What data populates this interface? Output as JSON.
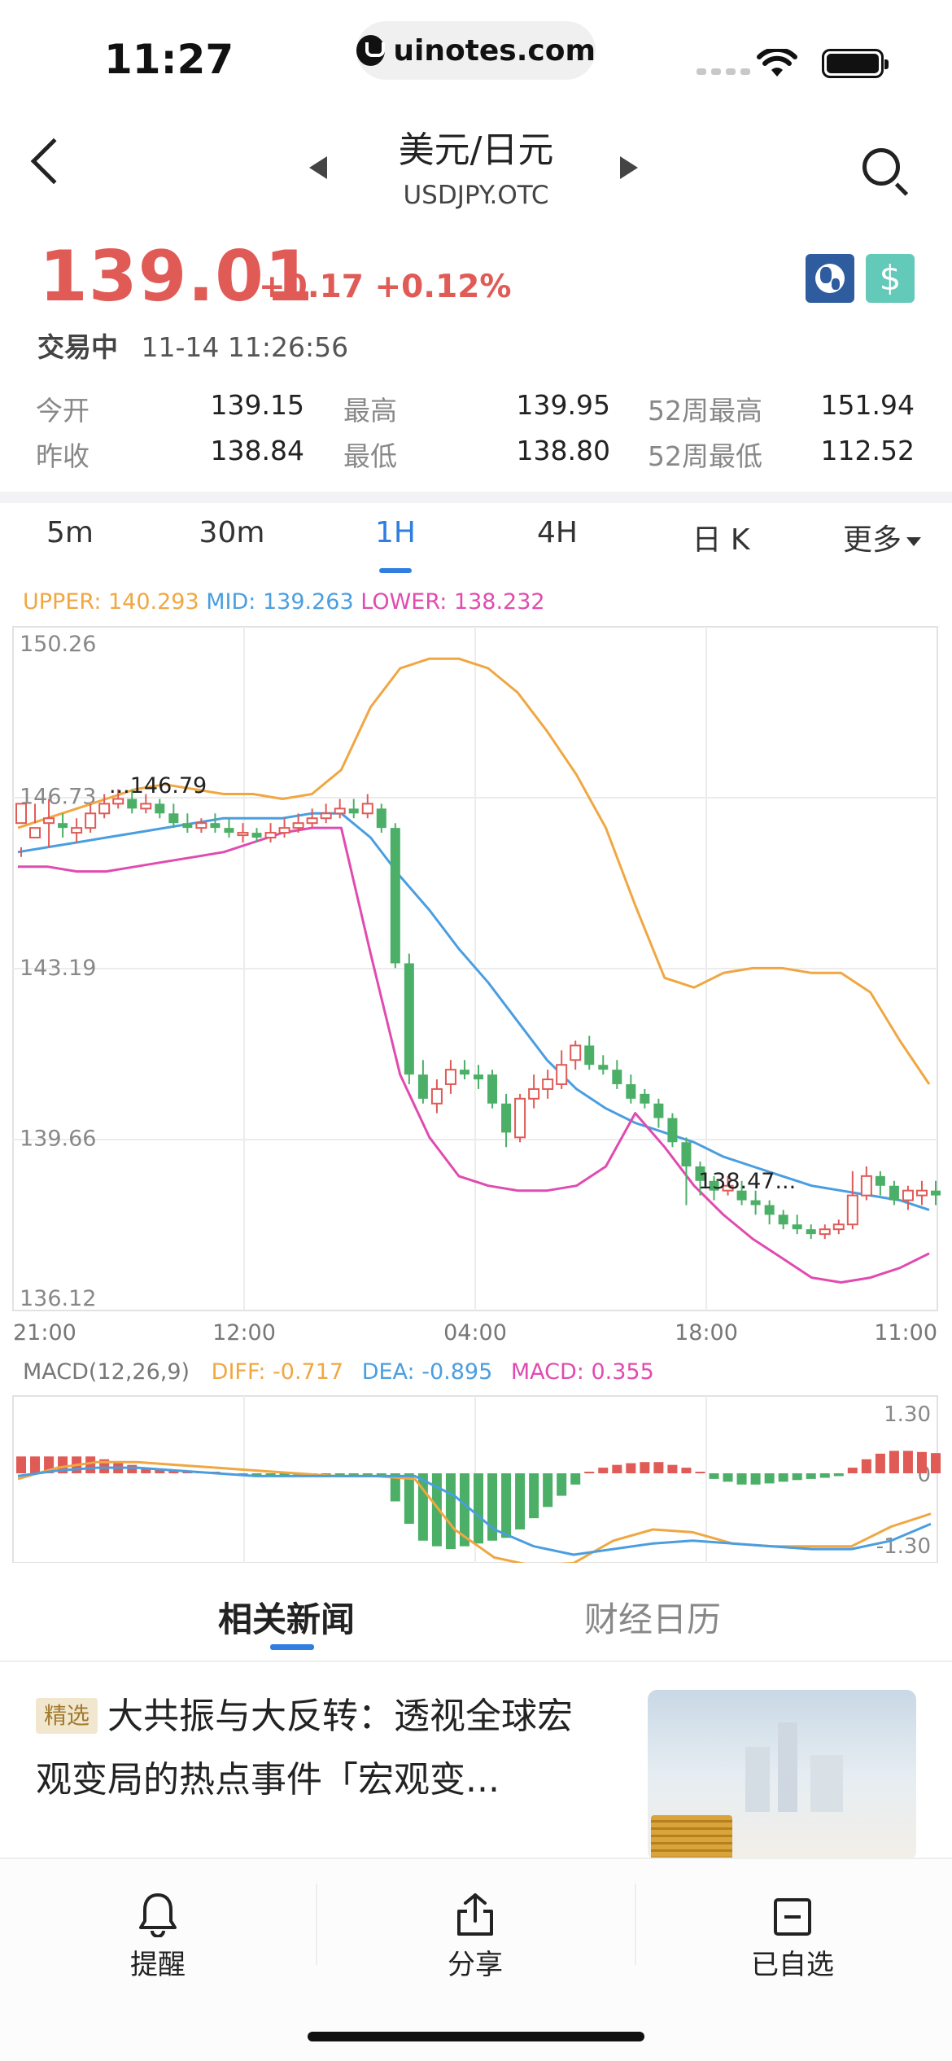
{
  "status_bar": {
    "time": "11:27",
    "site": "uinotes.com"
  },
  "nav": {
    "title": "美元/日元",
    "subtitle": "USDJPY.OTC"
  },
  "quote": {
    "price": "139.01",
    "change": "+0.17",
    "change_pct": "+0.12%",
    "state": "交易中",
    "timestamp": "11-14 11:26:56"
  },
  "stats": {
    "row1": [
      {
        "label": "今开",
        "value": "139.15"
      },
      {
        "label": "最高",
        "value": "139.95"
      },
      {
        "label": "52周最高",
        "value": "151.94"
      }
    ],
    "row2": [
      {
        "label": "昨收",
        "value": "138.84"
      },
      {
        "label": "最低",
        "value": "138.80"
      },
      {
        "label": "52周最低",
        "value": "112.52"
      }
    ]
  },
  "tabs": [
    "5m",
    "30m",
    "1H",
    "4H",
    "日 K",
    "更多"
  ],
  "active_tab": "1H",
  "colors": {
    "up": "#e05a56",
    "down": "#4caf67",
    "upper": "#f0a742",
    "mid": "#4a9ee0",
    "lower": "#e04bb0",
    "accent": "#2f7ee0"
  },
  "boll_legend": {
    "upper": "UPPER: 140.293",
    "mid": "MID: 139.263",
    "lower": "LOWER: 138.232"
  },
  "macd_legend": {
    "title": "MACD(12,26,9)",
    "diff": "DIFF: -0.717",
    "dea": "DEA: -0.895",
    "macd": "MACD: 0.355"
  },
  "chart_data": [
    {
      "type": "candlestick",
      "indicator": "BOLL",
      "y_ticks": [
        "150.26",
        "146.73",
        "143.19",
        "139.66",
        "136.12"
      ],
      "ylim": [
        136.12,
        150.26
      ],
      "x_ticks": [
        "21:00",
        "12:00",
        "04:00",
        "18:00",
        "11:00"
      ],
      "annotations": [
        {
          "text": "...146.79"
        },
        {
          "text": "138.47..."
        }
      ],
      "candles": [
        [
          146.2,
          146.6,
          145.5,
          145.7
        ],
        [
          145.9,
          146.1,
          146.6,
          146.2
        ],
        [
          146.2,
          146.3,
          146.7,
          145.7
        ],
        [
          146.2,
          146.1,
          146.4,
          145.9
        ],
        [
          146.0,
          146.1,
          146.3,
          145.8
        ],
        [
          146.1,
          146.4,
          146.6,
          146.0
        ],
        [
          146.4,
          146.6,
          146.8,
          146.3
        ],
        [
          146.6,
          146.7,
          146.9,
          146.5
        ],
        [
          146.7,
          146.5,
          146.9,
          146.4
        ],
        [
          146.5,
          146.6,
          146.8,
          146.4
        ],
        [
          146.6,
          146.4,
          146.7,
          146.3
        ],
        [
          146.4,
          146.2,
          146.6,
          146.1
        ],
        [
          146.2,
          146.1,
          146.4,
          146.0
        ],
        [
          146.1,
          146.2,
          146.3,
          146.0
        ],
        [
          146.2,
          146.1,
          146.4,
          146.0
        ],
        [
          146.1,
          146.0,
          146.3,
          145.9
        ],
        [
          146.0,
          146.0,
          146.2,
          145.8
        ],
        [
          146.0,
          145.9,
          146.1,
          145.8
        ],
        [
          145.9,
          146.0,
          146.2,
          145.8
        ],
        [
          146.0,
          146.1,
          146.3,
          145.9
        ],
        [
          146.1,
          146.2,
          146.4,
          146.0
        ],
        [
          146.2,
          146.3,
          146.5,
          146.1
        ],
        [
          146.3,
          146.4,
          146.6,
          146.2
        ],
        [
          146.4,
          146.5,
          146.7,
          146.3
        ],
        [
          146.5,
          146.4,
          146.7,
          146.3
        ],
        [
          146.4,
          146.6,
          146.8,
          146.3
        ],
        [
          146.5,
          146.1,
          146.6,
          146.0
        ],
        [
          146.1,
          143.3,
          146.2,
          143.2
        ],
        [
          143.3,
          141.0,
          143.5,
          140.8
        ],
        [
          141.0,
          140.5,
          141.3,
          140.4
        ],
        [
          140.4,
          140.7,
          140.9,
          140.2
        ],
        [
          140.8,
          141.1,
          141.3,
          140.6
        ],
        [
          141.1,
          141.0,
          141.3,
          140.9
        ],
        [
          141.0,
          140.9,
          141.2,
          140.7
        ],
        [
          141.0,
          140.4,
          141.1,
          140.3
        ],
        [
          140.4,
          139.8,
          140.6,
          139.5
        ],
        [
          139.7,
          140.5,
          140.6,
          139.6
        ],
        [
          140.5,
          140.7,
          141.0,
          140.3
        ],
        [
          140.7,
          140.9,
          141.1,
          140.5
        ],
        [
          140.8,
          141.2,
          141.5,
          140.7
        ],
        [
          141.3,
          141.6,
          141.7,
          141.1
        ],
        [
          141.6,
          141.2,
          141.8,
          141.1
        ],
        [
          141.2,
          141.1,
          141.4,
          141.0
        ],
        [
          141.1,
          140.8,
          141.3,
          140.7
        ],
        [
          140.8,
          140.5,
          141.0,
          140.4
        ],
        [
          140.6,
          140.4,
          140.7,
          140.3
        ],
        [
          140.4,
          140.1,
          140.5,
          139.9
        ],
        [
          140.1,
          139.6,
          140.2,
          139.5
        ],
        [
          139.6,
          139.1,
          139.7,
          138.3
        ],
        [
          139.1,
          138.8,
          139.2,
          138.5
        ],
        [
          138.8,
          138.6,
          138.9,
          138.4
        ],
        [
          138.6,
          138.7,
          138.9,
          138.5
        ],
        [
          138.6,
          138.4,
          138.8,
          138.3
        ],
        [
          138.4,
          138.3,
          138.6,
          138.1
        ],
        [
          138.3,
          138.1,
          138.4,
          137.9
        ],
        [
          138.1,
          137.9,
          138.2,
          137.8
        ],
        [
          137.9,
          137.8,
          138.1,
          137.7
        ],
        [
          137.8,
          137.7,
          137.9,
          137.6
        ],
        [
          137.7,
          137.8,
          137.9,
          137.6
        ],
        [
          137.8,
          137.9,
          138.0,
          137.7
        ],
        [
          137.9,
          138.5,
          139.0,
          137.8
        ],
        [
          138.5,
          138.9,
          139.1,
          138.4
        ],
        [
          138.9,
          138.7,
          139.0,
          138.5
        ],
        [
          138.7,
          138.4,
          138.8,
          138.3
        ],
        [
          138.4,
          138.6,
          138.7,
          138.2
        ],
        [
          138.5,
          138.6,
          138.8,
          138.3
        ],
        [
          138.6,
          138.5,
          138.8,
          138.3
        ]
      ],
      "series": [
        {
          "name": "UPPER",
          "values": [
            146.1,
            146.3,
            146.5,
            146.7,
            146.9,
            147.0,
            146.9,
            146.8,
            146.8,
            146.7,
            146.8,
            147.3,
            148.6,
            149.4,
            149.6,
            149.6,
            149.4,
            148.9,
            148.1,
            147.2,
            146.1,
            144.5,
            143.0,
            142.8,
            143.1,
            143.2,
            143.2,
            143.1,
            143.1,
            142.7,
            141.7,
            140.8
          ]
        },
        {
          "name": "MID",
          "values": [
            145.6,
            145.7,
            145.8,
            145.9,
            146.0,
            146.1,
            146.2,
            146.3,
            146.3,
            146.3,
            146.4,
            146.4,
            145.9,
            145.1,
            144.4,
            143.6,
            142.9,
            142.1,
            141.3,
            140.7,
            140.3,
            140.0,
            139.8,
            139.6,
            139.3,
            139.1,
            138.9,
            138.7,
            138.6,
            138.5,
            138.4,
            138.2
          ]
        },
        {
          "name": "LOWER",
          "values": [
            145.3,
            145.3,
            145.2,
            145.2,
            145.3,
            145.4,
            145.5,
            145.6,
            145.8,
            146.0,
            146.1,
            146.1,
            143.5,
            141.0,
            139.7,
            138.9,
            138.7,
            138.6,
            138.6,
            138.7,
            139.1,
            140.2,
            139.5,
            138.7,
            138.1,
            137.6,
            137.2,
            136.8,
            136.7,
            136.8,
            137.0,
            137.3
          ]
        }
      ]
    },
    {
      "type": "bar+line",
      "indicator": "MACD(12,26,9)",
      "y_ticks": [
        "1.30",
        "0",
        "-1.30"
      ],
      "ylim": [
        -1.3,
        1.3
      ],
      "histogram": [
        0.3,
        0.3,
        0.3,
        0.3,
        0.3,
        0.3,
        0.25,
        0.2,
        0.15,
        0.1,
        0.08,
        0.05,
        0.03,
        0.02,
        0.0,
        -0.02,
        -0.03,
        -0.05,
        -0.05,
        -0.05,
        -0.04,
        -0.03,
        -0.02,
        -0.02,
        -0.02,
        -0.02,
        -0.05,
        -0.5,
        -0.9,
        -1.2,
        -1.3,
        -1.35,
        -1.3,
        -1.25,
        -1.2,
        -1.15,
        -1.0,
        -0.8,
        -0.6,
        -0.4,
        -0.2,
        0.0,
        0.1,
        0.15,
        0.18,
        0.2,
        0.2,
        0.15,
        0.1,
        0.0,
        -0.1,
        -0.15,
        -0.2,
        -0.2,
        -0.18,
        -0.15,
        -0.12,
        -0.1,
        -0.08,
        -0.05,
        0.1,
        0.25,
        0.35,
        0.4,
        0.4,
        0.38,
        0.36
      ],
      "series": [
        {
          "name": "DIFF",
          "values": [
            -0.1,
            0.1,
            0.2,
            0.2,
            0.15,
            0.1,
            0.05,
            0.0,
            -0.05,
            -0.05,
            -0.1,
            -1.0,
            -1.5,
            -1.65,
            -1.6,
            -1.2,
            -1.0,
            -1.05,
            -1.25,
            -1.3,
            -1.3,
            -1.3,
            -0.95,
            -0.72
          ]
        },
        {
          "name": "DEA",
          "values": [
            -0.05,
            0.05,
            0.1,
            0.1,
            0.05,
            0.0,
            -0.05,
            -0.05,
            -0.05,
            -0.05,
            -0.05,
            -0.4,
            -1.0,
            -1.3,
            -1.45,
            -1.35,
            -1.25,
            -1.2,
            -1.25,
            -1.3,
            -1.35,
            -1.35,
            -1.2,
            -0.9
          ]
        }
      ]
    }
  ],
  "news": {
    "tabs": [
      "相关新闻",
      "财经日历"
    ],
    "tag": "精选",
    "headline": "大共振与大反转：透视全球宏观变局的热点事件「宏观变..."
  },
  "bottom_bar": {
    "alert": "提醒",
    "share": "分享",
    "watch": "已自选"
  }
}
